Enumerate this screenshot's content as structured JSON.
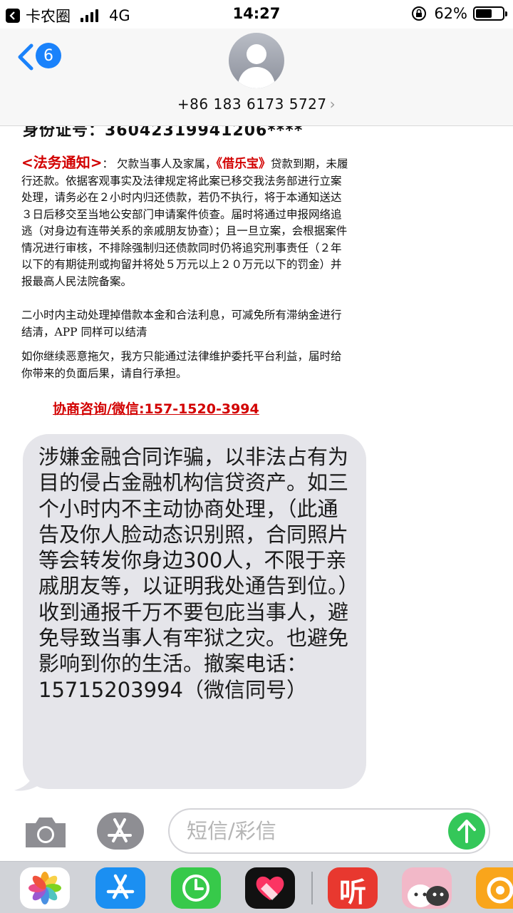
{
  "status_bar": {
    "carrier": "卡农圈",
    "network": "4G",
    "time": "14:27",
    "battery": "62%",
    "battery_level": 0.62
  },
  "header": {
    "unread_count": "6",
    "phone_number": "+86 183 6173 5727",
    "chevron": "›"
  },
  "document": {
    "cut_line": "身份证号：36042319941206****",
    "notice_title": "<法务通知>",
    "notice_colon": "：",
    "notice_intro": "欠款当事人及家属，",
    "platform_name": "《借乐宝》",
    "notice_body": "贷款到期，未履行还款。依据客观事实及法律规定将此案已移交我法务部进行立案处理，请务必在２小时内归还债款，若仍不执行，将于本通知送达３日后移交至当地公安部门申请案件侦查。届时将通过申报网络追逃（对身边有连带关系的亲戚朋友协查）；且一旦立案，会根据案件情况进行审核，不排除强制归还债款同时仍将追究刑事责任（２年以下的有期徒刑或拘留并将处５万元以上２０万元以下的罚金）并报最高人民法院备案。",
    "paragraph_2": "二小时内主动处理掉借款本金和合法利息，可减免所有滞纳金进行结清，APP 同样可以结清",
    "paragraph_3": "如你继续恶意拖欠，我方只能通过法律维护委托平台利益，届时给你带来的负面后果，请自行承担。",
    "contact": "协商咨询/微信:157-1520-3994"
  },
  "message": {
    "text": "涉嫌金融合同诈骗，以非法占有为目的侵占金融机构信贷资产。如三个小时内不主动协商处理，（此通告及你人脸动态识别照，合同照片等会转发你身边300人，不限于亲戚朋友等，以证明我处通告到位。）收到通报千万不要包庇当事人，避免导致当事人有牢狱之灾。也避免影响到你的生活。撤案电话：15715203994（微信同号）"
  },
  "input_bar": {
    "placeholder": "短信/彩信"
  },
  "app_drawer": {
    "apps": [
      "photos-app",
      "app-store-app",
      "clock-app",
      "health-app",
      "ting-app",
      "cat-sticker-app",
      "uc-browser-app"
    ],
    "ting_label": "听"
  },
  "colors": {
    "accent_blue": "#1a82fb",
    "bubble_gray": "#e5e5ea",
    "send_green": "#34c759",
    "notice_red": "#d20000"
  }
}
